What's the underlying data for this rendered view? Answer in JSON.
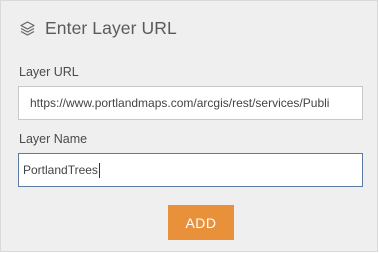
{
  "header": {
    "icon": "layers-icon",
    "title": "Enter Layer URL"
  },
  "form": {
    "url_label": "Layer URL",
    "url_value": "https://www.portlandmaps.com/arcgis/rest/services/Publi",
    "name_label": "Layer Name",
    "name_value": "PortlandTrees"
  },
  "actions": {
    "add_label": "ADD"
  },
  "colors": {
    "panel_bg": "#efefef",
    "accent": "#e9913a",
    "focus_border": "#5b7ba3"
  }
}
